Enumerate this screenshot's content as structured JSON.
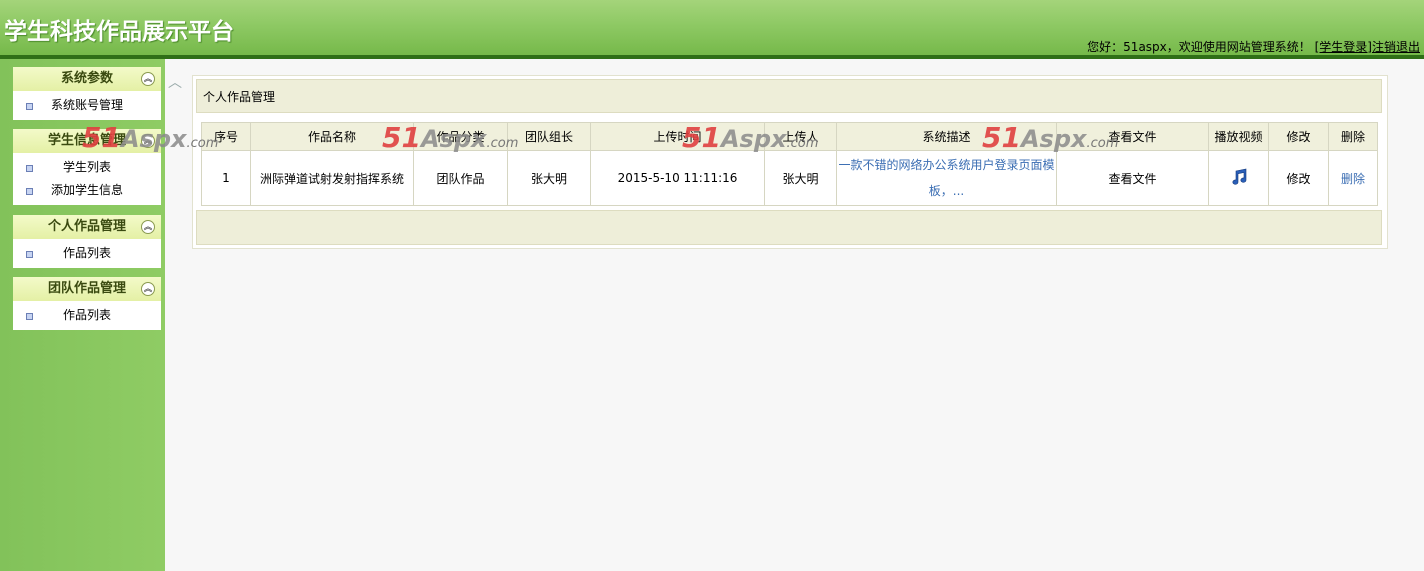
{
  "header": {
    "title": "学生科技作品展示平台",
    "welcome_text": "您好：51aspx，欢迎使用网站管理系统！",
    "role_link": "[学生登录]",
    "logout_link": "注销退出"
  },
  "sidebar": {
    "groups": [
      {
        "title": "系统参数",
        "items": [
          "系统账号管理"
        ]
      },
      {
        "title": "学生信息管理",
        "items": [
          "学生列表",
          "添加学生信息"
        ]
      },
      {
        "title": "个人作品管理",
        "items": [
          "作品列表"
        ]
      },
      {
        "title": "团队作品管理",
        "items": [
          "作品列表"
        ]
      }
    ]
  },
  "main": {
    "panel_title": "个人作品管理",
    "table": {
      "headers": [
        "序号",
        "作品名称",
        "作品分类",
        "团队组长",
        "上传时间",
        "上传人",
        "系统描述",
        "查看文件",
        "播放视频",
        "修改",
        "删除"
      ],
      "rows": [
        {
          "index": "1",
          "name": "洲际弹道试射发射指挥系统",
          "category": "团队作品",
          "leader": "张大明",
          "upload_time": "2015-5-10 11:11:16",
          "uploader": "张大明",
          "description_line1": "一款不错的网络办公系统用户登录页面模",
          "description_line2": "板，...",
          "view_file": "查看文件",
          "play_icon": "music-note-icon",
          "edit": "修改",
          "delete": "删除"
        }
      ]
    }
  },
  "watermark": {
    "num": "51",
    "brand": "Aspx",
    "suffix": ".com"
  },
  "colors": {
    "header_green": "#8ec964",
    "sidebar_green": "#8fcc64",
    "link_blue": "#3b6eb3",
    "watermark_red": "#e04040"
  }
}
